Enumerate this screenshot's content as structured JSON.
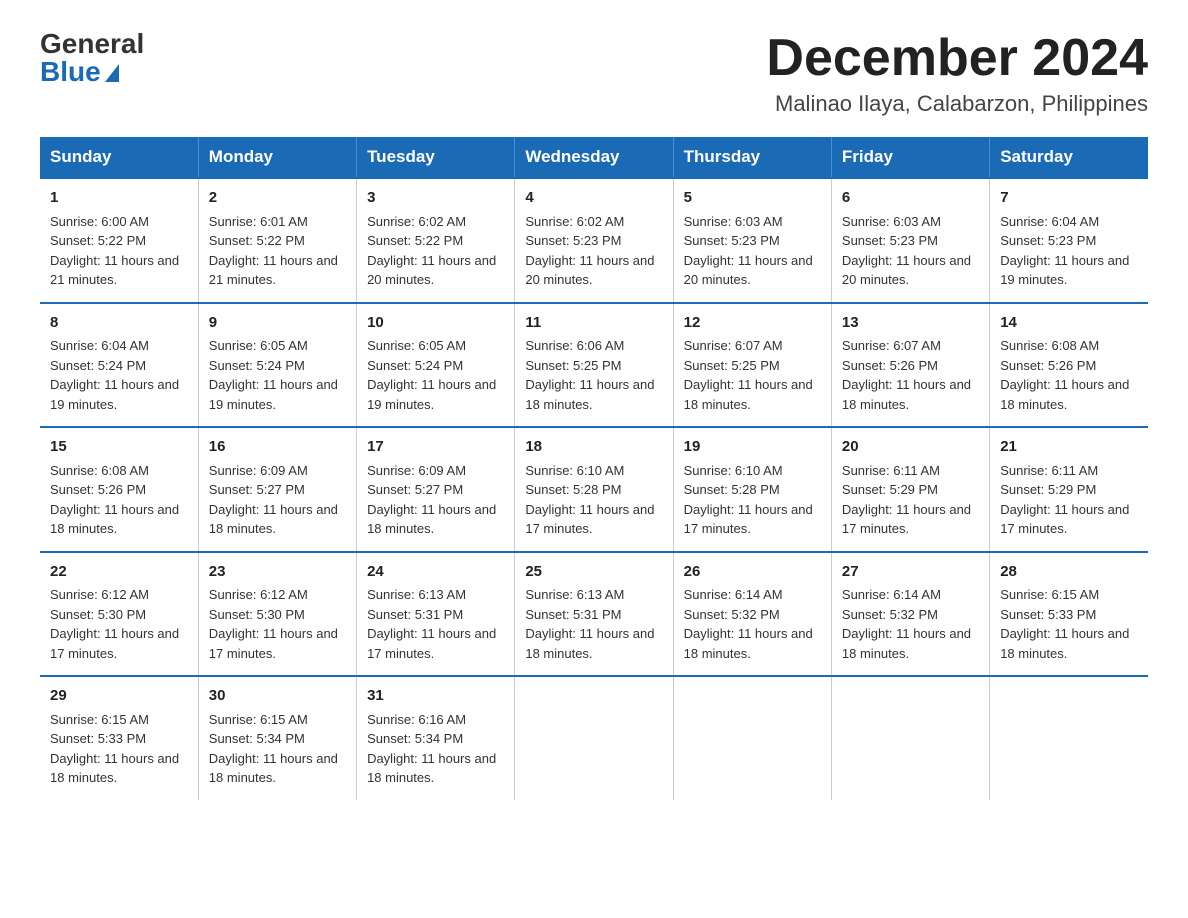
{
  "header": {
    "logo_general": "General",
    "logo_blue": "Blue",
    "month_title": "December 2024",
    "location": "Malinao Ilaya, Calabarzon, Philippines"
  },
  "days_of_week": [
    "Sunday",
    "Monday",
    "Tuesday",
    "Wednesday",
    "Thursday",
    "Friday",
    "Saturday"
  ],
  "weeks": [
    [
      {
        "day": "1",
        "sunrise": "6:00 AM",
        "sunset": "5:22 PM",
        "daylight": "11 hours and 21 minutes."
      },
      {
        "day": "2",
        "sunrise": "6:01 AM",
        "sunset": "5:22 PM",
        "daylight": "11 hours and 21 minutes."
      },
      {
        "day": "3",
        "sunrise": "6:02 AM",
        "sunset": "5:22 PM",
        "daylight": "11 hours and 20 minutes."
      },
      {
        "day": "4",
        "sunrise": "6:02 AM",
        "sunset": "5:23 PM",
        "daylight": "11 hours and 20 minutes."
      },
      {
        "day": "5",
        "sunrise": "6:03 AM",
        "sunset": "5:23 PM",
        "daylight": "11 hours and 20 minutes."
      },
      {
        "day": "6",
        "sunrise": "6:03 AM",
        "sunset": "5:23 PM",
        "daylight": "11 hours and 20 minutes."
      },
      {
        "day": "7",
        "sunrise": "6:04 AM",
        "sunset": "5:23 PM",
        "daylight": "11 hours and 19 minutes."
      }
    ],
    [
      {
        "day": "8",
        "sunrise": "6:04 AM",
        "sunset": "5:24 PM",
        "daylight": "11 hours and 19 minutes."
      },
      {
        "day": "9",
        "sunrise": "6:05 AM",
        "sunset": "5:24 PM",
        "daylight": "11 hours and 19 minutes."
      },
      {
        "day": "10",
        "sunrise": "6:05 AM",
        "sunset": "5:24 PM",
        "daylight": "11 hours and 19 minutes."
      },
      {
        "day": "11",
        "sunrise": "6:06 AM",
        "sunset": "5:25 PM",
        "daylight": "11 hours and 18 minutes."
      },
      {
        "day": "12",
        "sunrise": "6:07 AM",
        "sunset": "5:25 PM",
        "daylight": "11 hours and 18 minutes."
      },
      {
        "day": "13",
        "sunrise": "6:07 AM",
        "sunset": "5:26 PM",
        "daylight": "11 hours and 18 minutes."
      },
      {
        "day": "14",
        "sunrise": "6:08 AM",
        "sunset": "5:26 PM",
        "daylight": "11 hours and 18 minutes."
      }
    ],
    [
      {
        "day": "15",
        "sunrise": "6:08 AM",
        "sunset": "5:26 PM",
        "daylight": "11 hours and 18 minutes."
      },
      {
        "day": "16",
        "sunrise": "6:09 AM",
        "sunset": "5:27 PM",
        "daylight": "11 hours and 18 minutes."
      },
      {
        "day": "17",
        "sunrise": "6:09 AM",
        "sunset": "5:27 PM",
        "daylight": "11 hours and 18 minutes."
      },
      {
        "day": "18",
        "sunrise": "6:10 AM",
        "sunset": "5:28 PM",
        "daylight": "11 hours and 17 minutes."
      },
      {
        "day": "19",
        "sunrise": "6:10 AM",
        "sunset": "5:28 PM",
        "daylight": "11 hours and 17 minutes."
      },
      {
        "day": "20",
        "sunrise": "6:11 AM",
        "sunset": "5:29 PM",
        "daylight": "11 hours and 17 minutes."
      },
      {
        "day": "21",
        "sunrise": "6:11 AM",
        "sunset": "5:29 PM",
        "daylight": "11 hours and 17 minutes."
      }
    ],
    [
      {
        "day": "22",
        "sunrise": "6:12 AM",
        "sunset": "5:30 PM",
        "daylight": "11 hours and 17 minutes."
      },
      {
        "day": "23",
        "sunrise": "6:12 AM",
        "sunset": "5:30 PM",
        "daylight": "11 hours and 17 minutes."
      },
      {
        "day": "24",
        "sunrise": "6:13 AM",
        "sunset": "5:31 PM",
        "daylight": "11 hours and 17 minutes."
      },
      {
        "day": "25",
        "sunrise": "6:13 AM",
        "sunset": "5:31 PM",
        "daylight": "11 hours and 18 minutes."
      },
      {
        "day": "26",
        "sunrise": "6:14 AM",
        "sunset": "5:32 PM",
        "daylight": "11 hours and 18 minutes."
      },
      {
        "day": "27",
        "sunrise": "6:14 AM",
        "sunset": "5:32 PM",
        "daylight": "11 hours and 18 minutes."
      },
      {
        "day": "28",
        "sunrise": "6:15 AM",
        "sunset": "5:33 PM",
        "daylight": "11 hours and 18 minutes."
      }
    ],
    [
      {
        "day": "29",
        "sunrise": "6:15 AM",
        "sunset": "5:33 PM",
        "daylight": "11 hours and 18 minutes."
      },
      {
        "day": "30",
        "sunrise": "6:15 AM",
        "sunset": "5:34 PM",
        "daylight": "11 hours and 18 minutes."
      },
      {
        "day": "31",
        "sunrise": "6:16 AM",
        "sunset": "5:34 PM",
        "daylight": "11 hours and 18 minutes."
      },
      null,
      null,
      null,
      null
    ]
  ]
}
